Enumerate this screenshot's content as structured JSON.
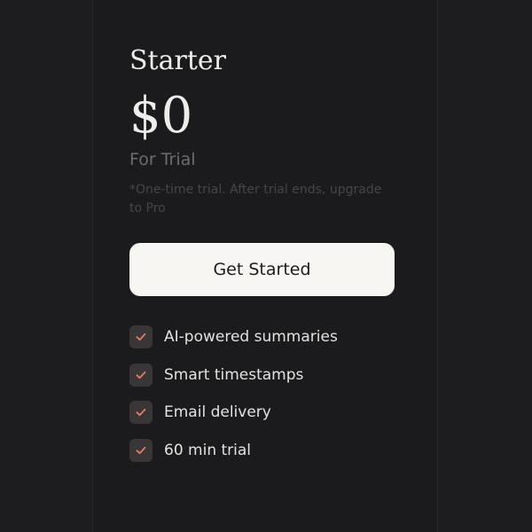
{
  "plan": {
    "name": "Starter",
    "price": "$0",
    "period": "For Trial",
    "note": "*One-time trial. After trial ends, upgrade to Pro"
  },
  "cta": {
    "label": "Get Started"
  },
  "features": [
    {
      "label": "AI-powered summaries",
      "icon": "check-icon"
    },
    {
      "label": "Smart timestamps",
      "icon": "check-icon"
    },
    {
      "label": "Email delivery",
      "icon": "check-icon"
    },
    {
      "label": "60 min trial",
      "icon": "check-icon"
    }
  ],
  "colors": {
    "background": "#1d1d20",
    "card": "#1b1b1e",
    "button": "#f7f6f2",
    "check_accent": "#e0806a",
    "check_bg": "#3a3537"
  }
}
